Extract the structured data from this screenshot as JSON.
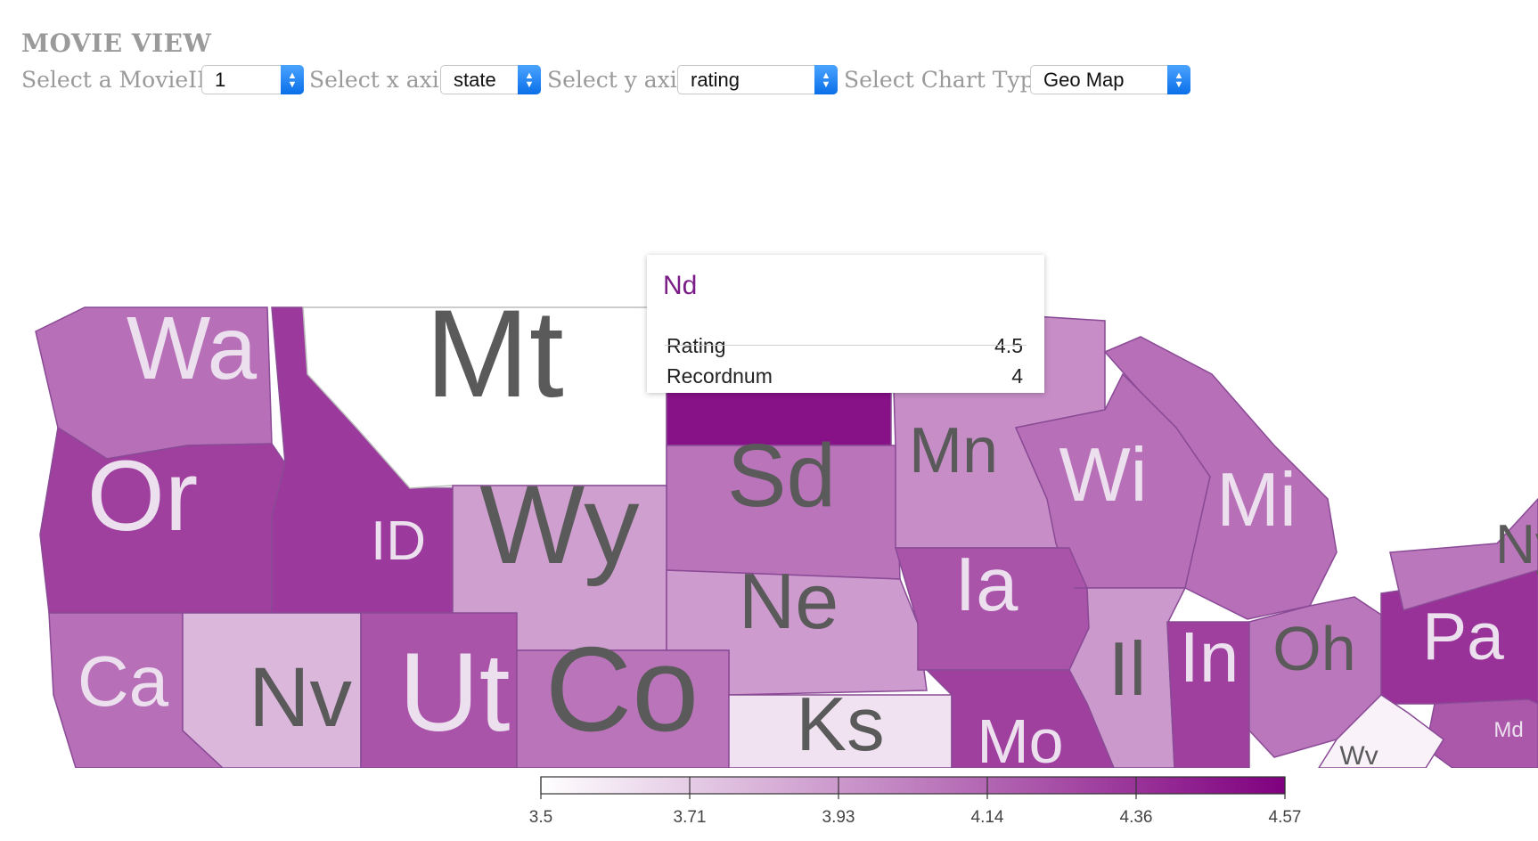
{
  "header": {
    "title": "MOVIE VIEW"
  },
  "controls": {
    "movie_label": "Select a MovieID",
    "movie_value": "1",
    "x_label": "Select x axis",
    "x_value": "state",
    "y_label": "Select y axis",
    "y_value": "rating",
    "chart_label": "Select Chart Type",
    "chart_value": "Geo Map"
  },
  "map": {
    "metric": "rating",
    "states": [
      {
        "abbr": "Wa",
        "rating": 4.1
      },
      {
        "abbr": "Or",
        "rating": 4.3
      },
      {
        "abbr": "ID",
        "rating": 4.33
      },
      {
        "abbr": "Mt",
        "rating": null
      },
      {
        "abbr": "Nd",
        "rating": 4.5
      },
      {
        "abbr": "Sd",
        "rating": 4.08
      },
      {
        "abbr": "Wy",
        "rating": 3.9
      },
      {
        "abbr": "Ne",
        "rating": 3.92
      },
      {
        "abbr": "Mn",
        "rating": 3.98
      },
      {
        "abbr": "Wi",
        "rating": 4.1
      },
      {
        "abbr": "Mi",
        "rating": 4.1
      },
      {
        "abbr": "Ia",
        "rating": 4.22
      },
      {
        "abbr": "Il",
        "rating": 3.93
      },
      {
        "abbr": "In",
        "rating": 4.3
      },
      {
        "abbr": "Oh",
        "rating": 4.07
      },
      {
        "abbr": "Pa",
        "rating": 4.36
      },
      {
        "abbr": "Ca",
        "rating": 4.1
      },
      {
        "abbr": "Nv",
        "rating": 3.8
      },
      {
        "abbr": "Ut",
        "rating": 4.22
      },
      {
        "abbr": "Co",
        "rating": 4.08
      },
      {
        "abbr": "Ks",
        "rating": 3.62
      },
      {
        "abbr": "Mo",
        "rating": 4.3
      },
      {
        "abbr": "Md",
        "rating": 4.2
      },
      {
        "abbr": "Wv",
        "rating": 3.55
      },
      {
        "abbr": "Ny",
        "rating": 4.07
      }
    ]
  },
  "tooltip": {
    "state": "Nd",
    "rows": [
      {
        "label": "Rating",
        "value": "4.5"
      },
      {
        "label": "Recordnum",
        "value": "4"
      }
    ]
  },
  "legend": {
    "min": 3.5,
    "max": 4.57,
    "ticks": [
      "3.5",
      "3.71",
      "3.93",
      "4.14",
      "4.36",
      "4.57"
    ],
    "color_low": "#ffffff",
    "color_high": "#7f007f"
  },
  "colors": {
    "label_dark": "#5a5a5a",
    "label_light": "#ece0ef",
    "border": "#8a4a96"
  }
}
